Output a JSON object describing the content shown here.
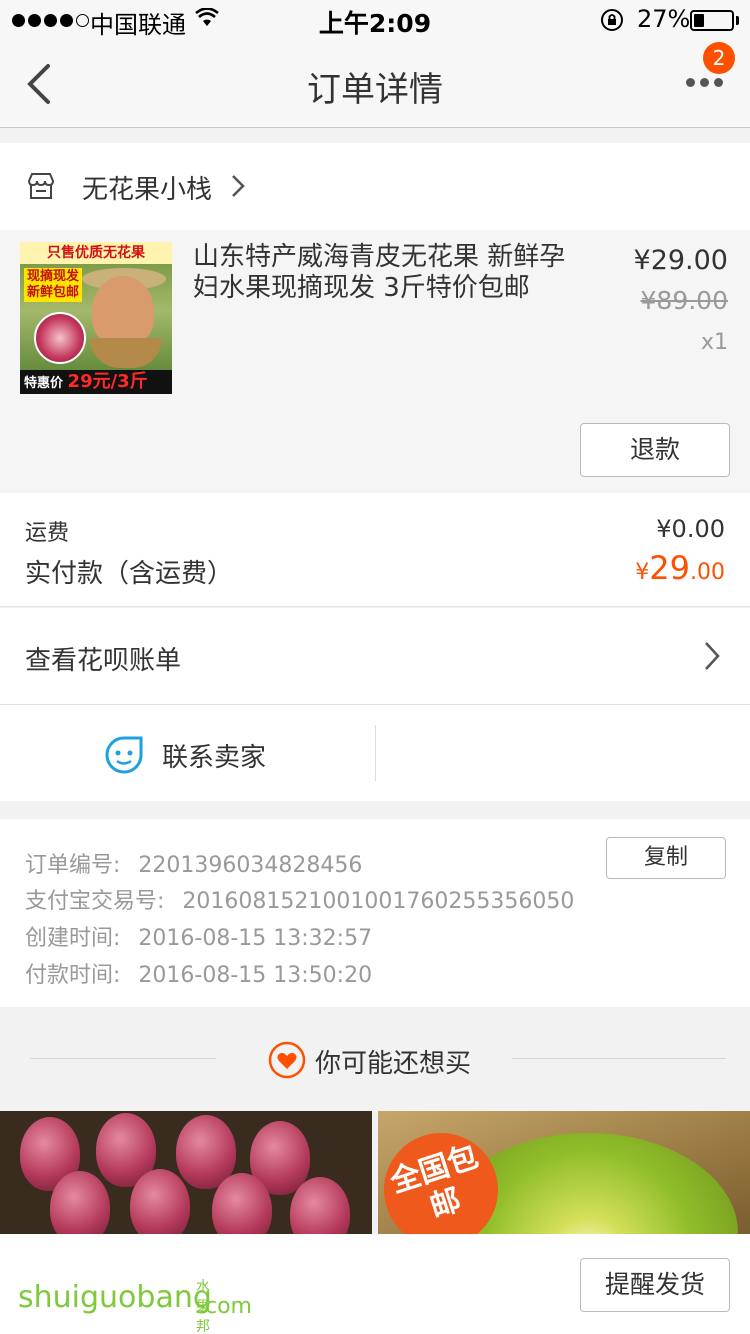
{
  "status_bar": {
    "carrier": "中国联通",
    "time": "上午2:09",
    "battery_percent": "27%",
    "battery_level": 0.27
  },
  "nav": {
    "title": "订单详情",
    "badge_count": "2"
  },
  "shop": {
    "name": "无花果小栈"
  },
  "product": {
    "image_banner": "只售优质无花果",
    "image_tag_line1": "现摘现发",
    "image_tag_line2": "新鲜包邮",
    "image_price_label": "特惠价",
    "image_price": "29元/3斤",
    "title": "山东特产威海青皮无花果 新鲜孕妇水果现摘现发 3斤特价包邮",
    "price": "¥29.00",
    "original_price": "¥89.00",
    "quantity": "x1",
    "refund_label": "退款"
  },
  "fees": {
    "shipping_label": "运费",
    "shipping_value": "¥0.00",
    "paid_label": "实付款（含运费）",
    "paid_currency": "¥",
    "paid_integer": "29",
    "paid_decimal": ".00"
  },
  "huabei": {
    "label": "查看花呗账单"
  },
  "contact": {
    "label": "联系卖家"
  },
  "order_info": {
    "order_no_label": "订单编号:",
    "order_no": "2201396034828456",
    "copy_label": "复制",
    "alipay_no_label": "支付宝交易号:",
    "alipay_no": "2016081521001001760255356050",
    "created_label": "创建时间:",
    "created": "2016-08-15 13:32:57",
    "paid_label": "付款时间:",
    "paid": "2016-08-15 13:50:20"
  },
  "recommend": {
    "label": "你可能还想买",
    "item2_badge": "全国包邮"
  },
  "bottom": {
    "remind_label": "提醒发货",
    "watermark": "shuiguobang",
    "watermark_cn": "水果邦",
    "watermark_domain": ".com"
  },
  "colors": {
    "accent": "#ff5000",
    "watermark": "#7fc93d",
    "contact_icon": "#1ea0e0"
  }
}
